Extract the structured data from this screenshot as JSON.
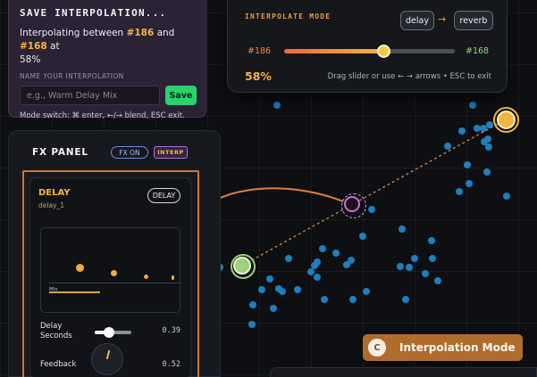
{
  "save_dialog": {
    "title": "SAVE INTERPOLATION...",
    "desc_prefix": "Interpolating between ",
    "from_id": "#186",
    "desc_mid": " and ",
    "to_id": "#168",
    "desc_suffix": " at",
    "percent": "58%",
    "name_label": "NAME YOUR INTERPOLATION",
    "name_placeholder": "e.g., Warm Delay Mix",
    "save_label": "Save",
    "mode_switch": "Mode switch: ⌘ enter, ←/→ blend, ESC exit."
  },
  "interp_panel": {
    "label": "INTERPOLATE MODE",
    "source_a": "delay",
    "arrow": "→",
    "source_b": "reverb",
    "from_id": "#186",
    "to_id": "#168",
    "blend_fraction": 0.58,
    "blend_percent": "58%",
    "hint": "Drag slider or use ← → arrows • ESC to exit"
  },
  "fx_panel": {
    "title": "FX PANEL",
    "fx_on_label": "FX ON",
    "interp_badge": "INTERP",
    "delay": {
      "title": "DELAY",
      "preset_id": "delay_1",
      "button_label": "DELAY",
      "mix_label": "Mix",
      "mix_level": 0.4,
      "delay_seconds_label": "Delay\nSeconds",
      "delay_seconds_value": "0.39",
      "delay_seconds_level": 0.39,
      "feedback_label": "Feedback",
      "feedback_value": "0.52"
    }
  },
  "toast": {
    "badge": "C",
    "text": "Interpolation Mode"
  },
  "colors": {
    "accent_orange": "#f5b541",
    "delay_green": "#9dd17a",
    "blend_pink": "#c86fd6",
    "scatter_blue": "#1e7fbf",
    "save_green": "#2bd16e"
  }
}
